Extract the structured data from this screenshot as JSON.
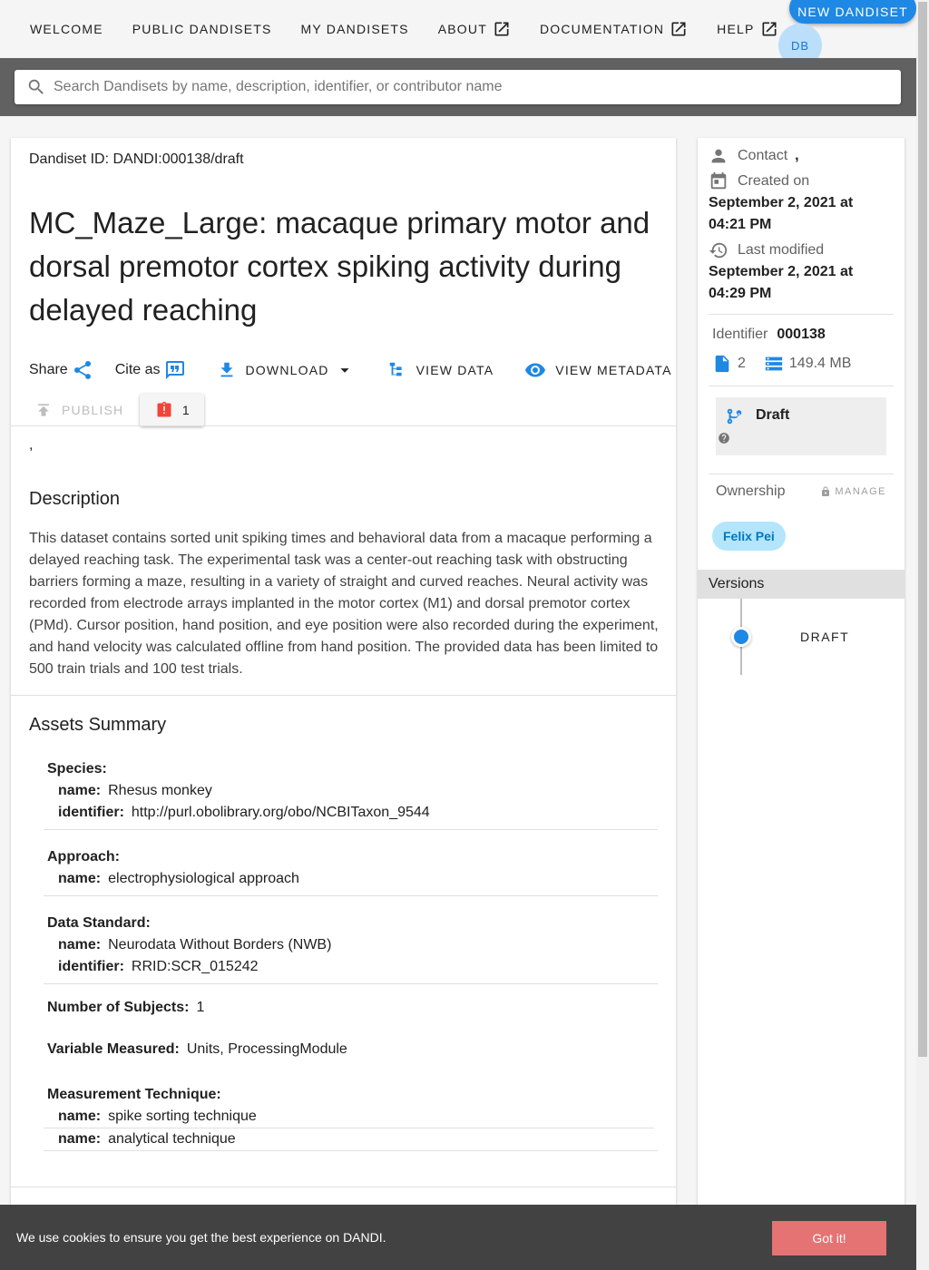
{
  "nav": {
    "welcome": "WELCOME",
    "public_dandisets": "PUBLIC DANDISETS",
    "my_dandisets": "MY DANDISETS",
    "about": "ABOUT",
    "documentation": "DOCUMENTATION",
    "help": "HELP",
    "new_dandiset": "NEW DANDISET",
    "avatar_initials": "DB"
  },
  "search": {
    "placeholder": "Search Dandisets by name, description, identifier, or contributor name"
  },
  "dandiset": {
    "id_label": "Dandiset ID: DANDI:000138/draft",
    "title": "MC_Maze_Large: macaque primary motor and dorsal premotor cortex spiking activity during delayed reaching",
    "share_label": "Share",
    "cite_label": "Cite as",
    "download_label": "DOWNLOAD",
    "view_data_label": "VIEW DATA",
    "view_metadata_label": "VIEW METADATA",
    "publish_label": "PUBLISH",
    "error_count": "1",
    "contributors_line": ",",
    "description_heading": "Description",
    "description": "This dataset contains sorted unit spiking times and behavioral data from a macaque performing a delayed reaching task. The experimental task was a center-out reaching task with obstructing barriers forming a maze, resulting in a variety of straight and curved reaches. Neural activity was recorded from electrode arrays implanted in the motor cortex (M1) and dorsal premotor cortex (PMd). Cursor position, hand position, and eye position were also recorded during the experiment, and hand velocity was calculated offline from hand position. The provided data has been limited to 500 train trials and 100 test trials."
  },
  "assets": {
    "heading": "Assets Summary",
    "species_label": "Species:",
    "species_name_key": "name:",
    "species_name": "Rhesus monkey",
    "species_identifier_key": "identifier:",
    "species_identifier": "http://purl.obolibrary.org/obo/NCBITaxon_9544",
    "approach_label": "Approach:",
    "approach_name_key": "name:",
    "approach_name": "electrophysiological approach",
    "standard_label": "Data Standard:",
    "standard_name_key": "name:",
    "standard_name": "Neurodata Without Borders (NWB)",
    "standard_identifier_key": "identifier:",
    "standard_identifier": "RRID:SCR_015242",
    "subjects_label": "Number of Subjects:",
    "subjects_value": "1",
    "variable_label": "Variable Measured:",
    "variable_value": "Units, ProcessingModule",
    "technique_label": "Measurement Technique:",
    "technique_1_key": "name:",
    "technique_1": "spike sorting technique",
    "technique_2_key": "name:",
    "technique_2": "analytical technique"
  },
  "sidebar": {
    "contact_label": "Contact",
    "contact_value": ",",
    "created_label": "Created on",
    "created_value": "September 2, 2021 at 04:21 PM",
    "modified_label": "Last modified",
    "modified_value": "September 2, 2021 at 04:29 PM",
    "identifier_label": "Identifier",
    "identifier_value": "000138",
    "file_count": "2",
    "size": "149.4 MB",
    "draft_label": "Draft",
    "ownership_label": "Ownership",
    "manage_label": "MANAGE",
    "owner_name": "Felix Pei",
    "versions_heading": "Versions",
    "version_draft": "DRAFT"
  },
  "cookie": {
    "text": "We use cookies to ensure you get the best experience on DANDI.",
    "button": "Got it!"
  },
  "colors": {
    "accent": "#1e88e5",
    "chip_bg": "#b3e5fc",
    "error": "#f44336",
    "cookie_button": "#e57373"
  }
}
